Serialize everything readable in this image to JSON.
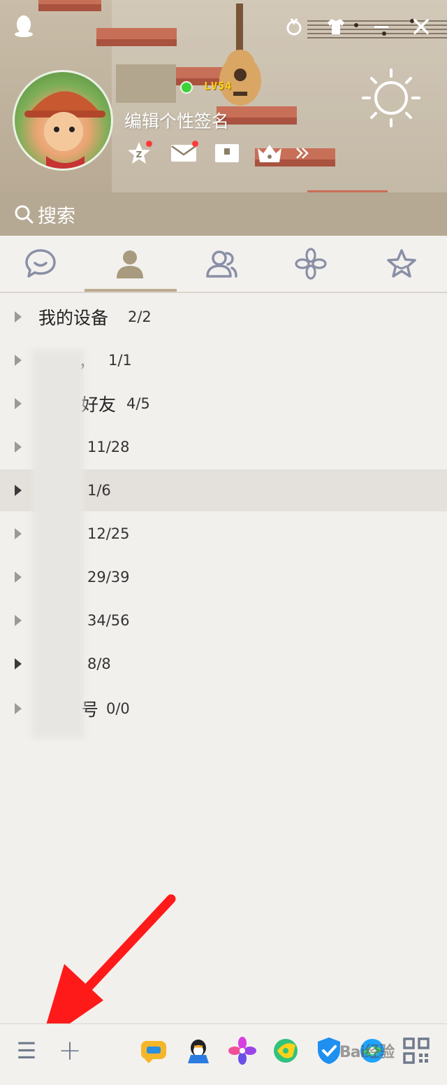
{
  "header": {
    "level": "LV54",
    "signature": "编辑个性签名",
    "status": "online",
    "status_color": "#3fd13a"
  },
  "search": {
    "placeholder": "搜索"
  },
  "tabs": [
    {
      "icon": "chat-bubble-icon",
      "active": false
    },
    {
      "icon": "contacts-icon",
      "active": true
    },
    {
      "icon": "group-icon",
      "active": false
    },
    {
      "icon": "flower-icon",
      "active": false
    },
    {
      "icon": "star-icon",
      "active": false
    }
  ],
  "groups": [
    {
      "name": "我的设备",
      "count": "2/2",
      "expanded": false,
      "highlighted": false
    },
    {
      "name": "，",
      "count": "1/1",
      "expanded": false,
      "highlighted": false
    },
    {
      "name": "好友",
      "count": "4/5",
      "expanded": false,
      "highlighted": false
    },
    {
      "name": "",
      "count": "11/28",
      "expanded": false,
      "highlighted": false
    },
    {
      "name": "",
      "count": "1/6",
      "expanded": false,
      "highlighted": true
    },
    {
      "name": "",
      "count": "12/25",
      "expanded": false,
      "highlighted": false
    },
    {
      "name": "",
      "count": "29/39",
      "expanded": false,
      "highlighted": false
    },
    {
      "name": "",
      "count": "34/56",
      "expanded": false,
      "highlighted": false
    },
    {
      "name": "",
      "count": "8/8",
      "expanded": false,
      "highlighted": false
    },
    {
      "name": "号",
      "count": "0/0",
      "expanded": false,
      "highlighted": false
    }
  ],
  "bottom_bar": {
    "menu": "☰",
    "add": "+",
    "apps": [
      "game-center-icon",
      "penguin-app-icon",
      "petal-app-icon",
      "music-app-icon",
      "security-shield-icon",
      "browser-app-icon",
      "qr-code-icon"
    ],
    "watermark": "Bai经验"
  },
  "colors": {
    "accent": "#bcab8e",
    "header_bg": "#c2b59f",
    "highlight_row": "#e4e0db",
    "arrow": "#ff1a1a"
  }
}
